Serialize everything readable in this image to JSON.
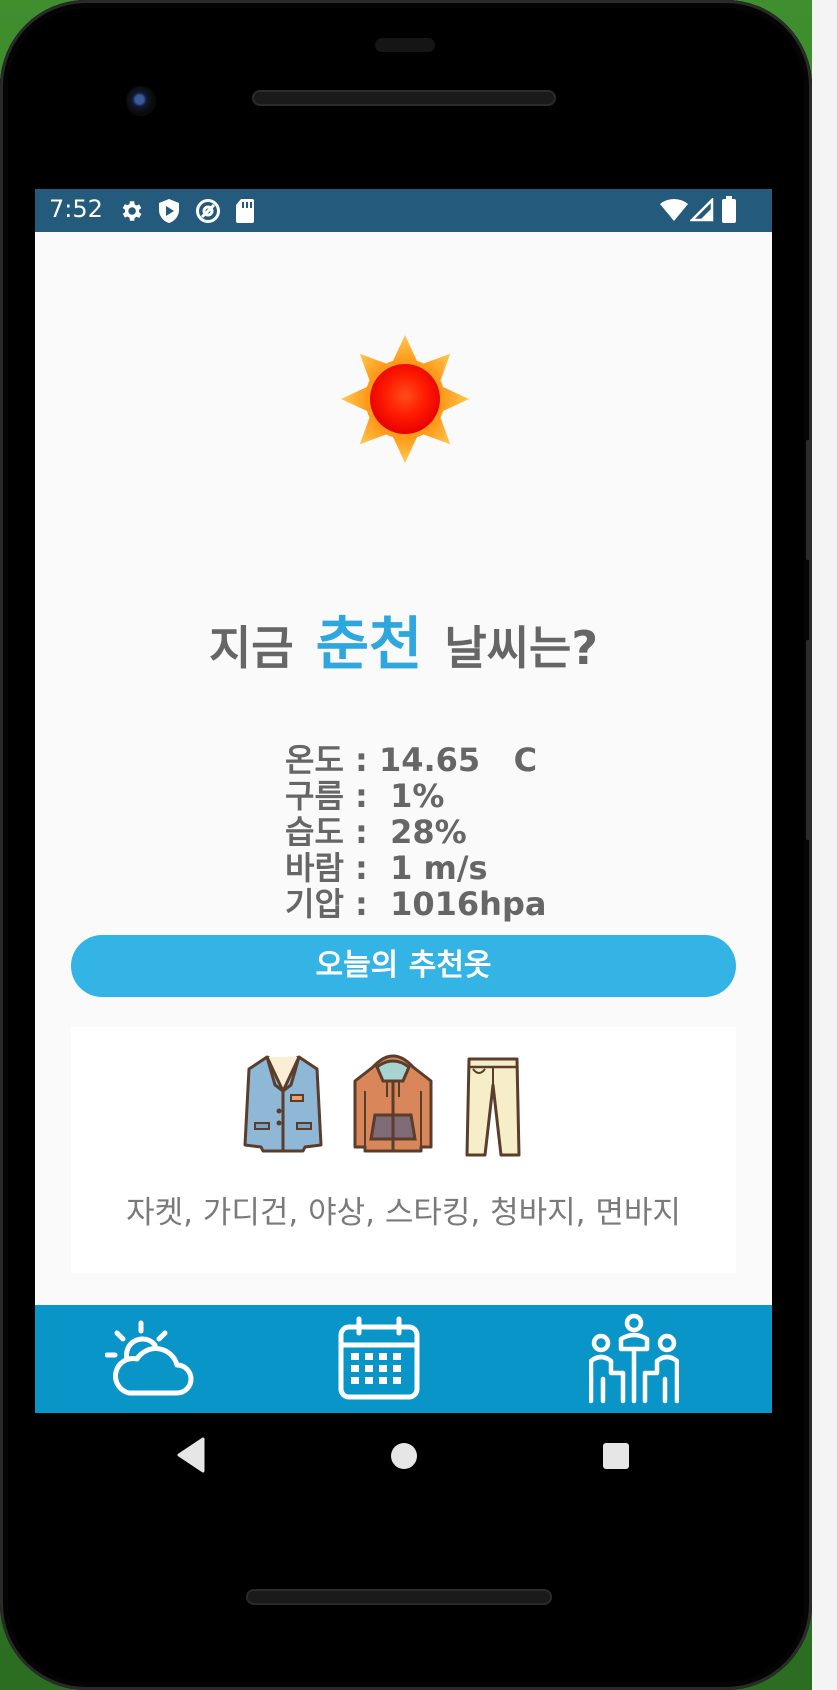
{
  "status_bar": {
    "time": "7:52",
    "icons": [
      "gear-icon",
      "shield-play-icon",
      "at-sign-icon",
      "sd-card-icon",
      "wifi-icon",
      "signal-icon",
      "battery-icon"
    ]
  },
  "weather_icon": "sun-icon",
  "title": {
    "prefix": "지금",
    "city": "춘천",
    "suffix": "날씨는?"
  },
  "weather": {
    "temperature_label": "온도",
    "temperature_value": "14.65   C",
    "cloud_label": "구름",
    "cloud_value": "1%",
    "humidity_label": "습도",
    "humidity_value": "28%",
    "wind_label": "바람",
    "wind_value": "1 m/s",
    "pressure_label": "기압",
    "pressure_value": "1016hpa"
  },
  "recommend_button": "오늘의 추천옷",
  "clothes": {
    "items": [
      "jacket-icon",
      "hoodie-icon",
      "pants-icon"
    ],
    "caption": "자켓, 가디건, 야상, 스타킹, 청바지, 면바지"
  },
  "bottom_nav": {
    "items": [
      "weather-cloud-sun-icon",
      "calendar-icon",
      "people-meeting-icon"
    ]
  },
  "system_nav": [
    "back-icon",
    "home-icon",
    "recents-icon"
  ],
  "colors": {
    "status_bar": "#245a7c",
    "accent": "#34b4e4",
    "city": "#2ea7df",
    "bottom_nav": "#0a95c8",
    "text": "#666666"
  }
}
